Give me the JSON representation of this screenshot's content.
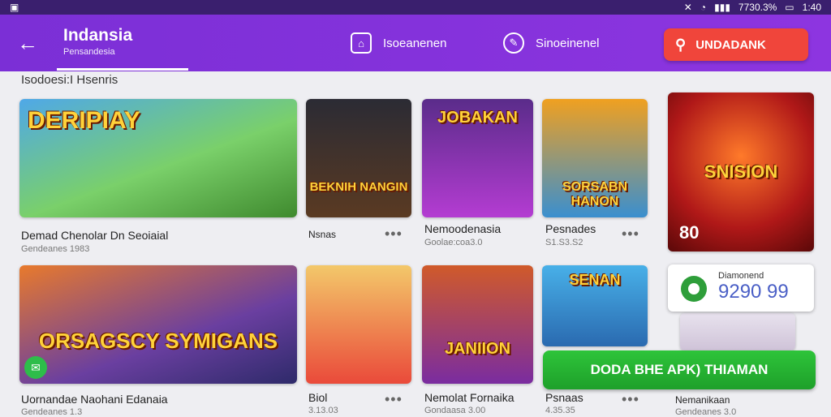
{
  "status": {
    "left_icon": "picture-icon",
    "battery": "7730.3%",
    "time": "1:40"
  },
  "appbar": {
    "title": "Indansia",
    "subtitle": "Pensandesia",
    "nav": [
      {
        "label": "Isoeanenen",
        "icon": "store-icon"
      },
      {
        "label": "Sinoeinenel",
        "icon": "bag-icon"
      }
    ],
    "search_label": "UNDADANK"
  },
  "section_title": "Isodoesi:I  Hsenris",
  "row1": [
    {
      "art": "DERIPIAY",
      "caption": "Demad Chenolar Dn Seoiaial",
      "sub": "Gendeanes 1983"
    },
    {
      "art": "BEKNIH NANGIN",
      "caption": "",
      "sub": ""
    },
    {
      "art": "JOBAKAN",
      "caption": "Nemoodenasia",
      "sub": "Goolae:coa3.0"
    },
    {
      "art": "SORSABN HANON",
      "caption": "Pesnades",
      "sub": "S1.S3.S2"
    },
    {
      "art": "SNISION",
      "caption": "",
      "sub": ""
    }
  ],
  "row1_extra": {
    "short_caption": "Nsnas",
    "badge": "80"
  },
  "row2": [
    {
      "art": "ORSAGSCY SYMIGANS",
      "caption": "Uornandae Naohani Edanaia",
      "sub": "Gendeanes 1.3"
    },
    {
      "art": "",
      "caption": "Biol",
      "sub": "3.13.03"
    },
    {
      "art": "JANIION",
      "caption": "Nemolat Fornaika",
      "sub": "Gondaasa 3.00"
    },
    {
      "art": "SENAN",
      "caption": "Psnaas",
      "sub": "4.35.35"
    },
    {
      "art": "",
      "caption": "Nemanikaan",
      "sub": "Gendeanes 3.0"
    }
  ],
  "rating": {
    "label": "Diamonend",
    "value": "9290 99"
  },
  "download_label": "DODA BHE APK) THIAMAN",
  "colors": {
    "appbar": "#7b2fd6",
    "search": "#f0453b",
    "download": "#28b532"
  }
}
